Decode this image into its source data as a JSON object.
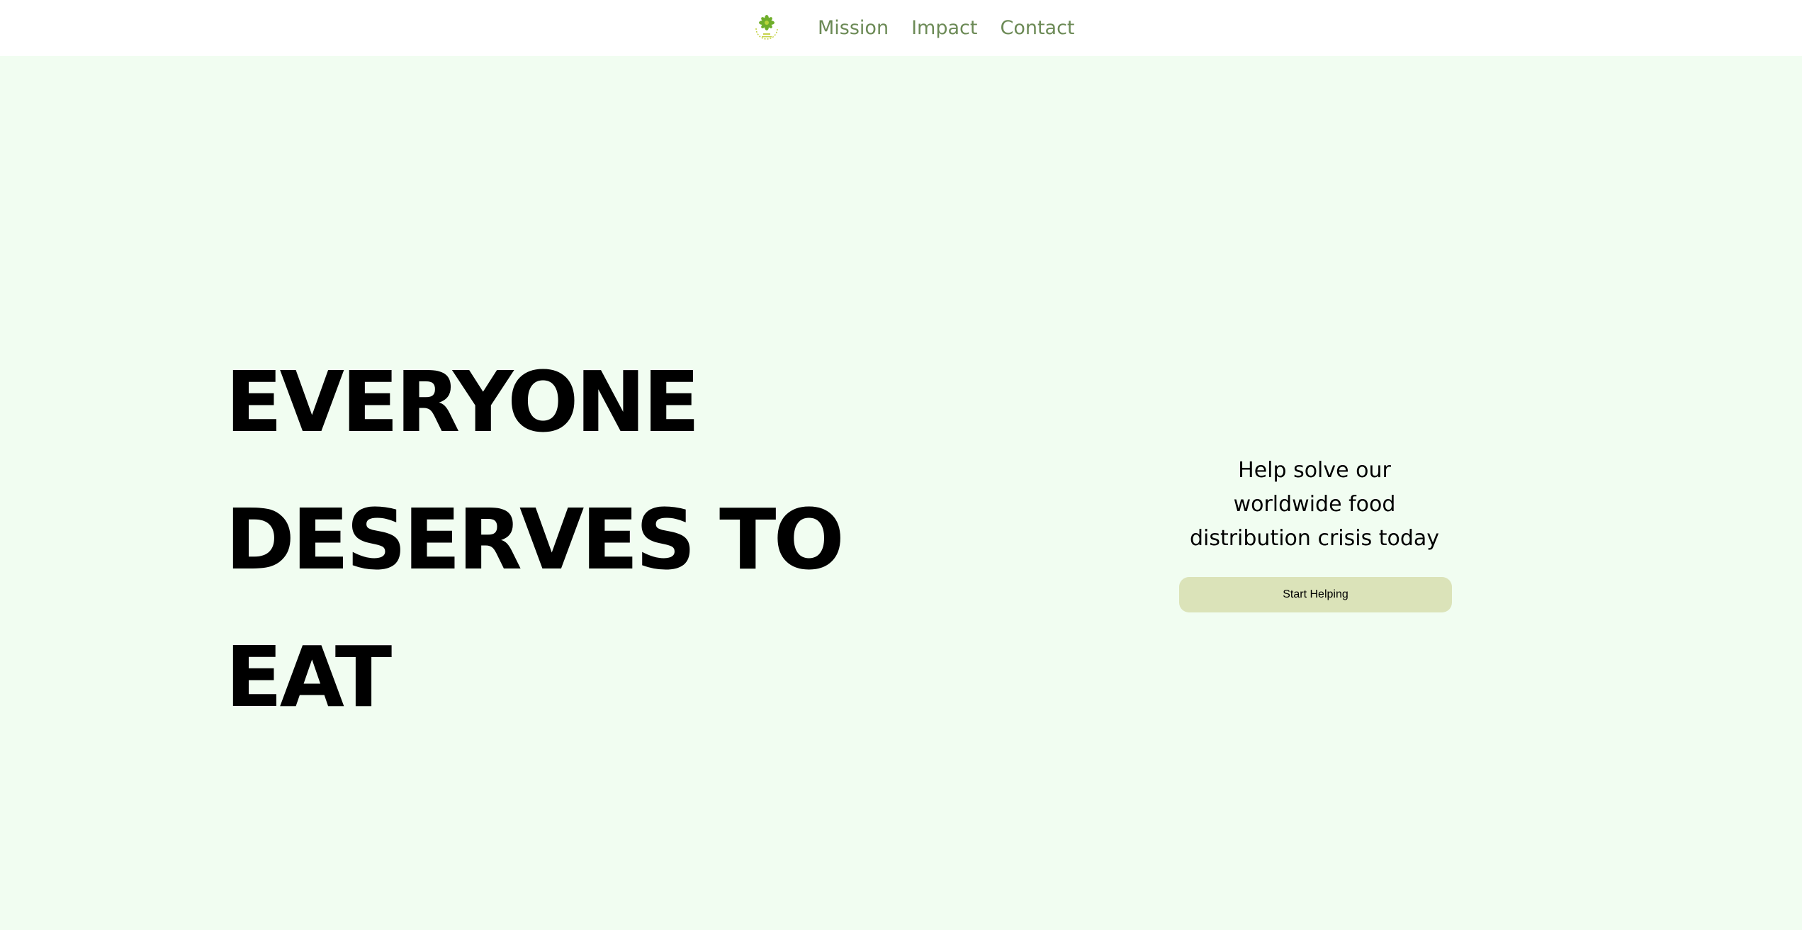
{
  "nav": {
    "logo_icon": "plant-seal-logo-icon",
    "links": [
      {
        "label": "Mission"
      },
      {
        "label": "Impact"
      },
      {
        "label": "Contact"
      }
    ]
  },
  "hero": {
    "title_lines": [
      "EVERYONE",
      "DESERVES TO",
      "EAT"
    ]
  },
  "cta": {
    "text": "Help solve our worldwide food distribution crisis today",
    "button_label": "Start Helping"
  },
  "colors": {
    "page_background": "#f1fdf1",
    "nav_background": "#ffffff",
    "nav_link": "#6c8a56",
    "button_background": "#dbe3b9"
  }
}
